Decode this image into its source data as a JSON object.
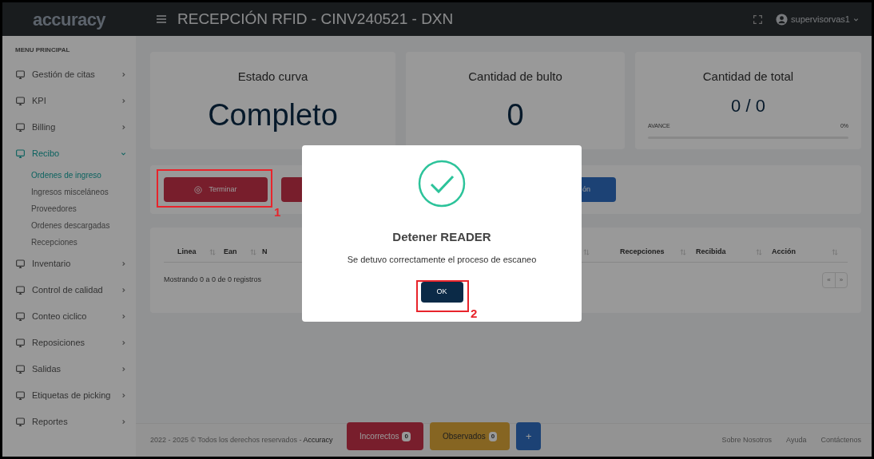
{
  "header": {
    "logo": "accuracy",
    "title": "RECEPCIÓN RFID - CINV240521 - DXN",
    "user": "supervisorvas1"
  },
  "sidebar": {
    "section_label": "MENU PRINCIPAL",
    "items": [
      {
        "label": "Gestión de citas",
        "expanded": false,
        "selected": false
      },
      {
        "label": "KPI",
        "expanded": false,
        "selected": false
      },
      {
        "label": "Billing",
        "expanded": false,
        "selected": false
      },
      {
        "label": "Recibo",
        "expanded": true,
        "selected": true,
        "children": [
          {
            "label": "Ordenes de ingreso",
            "selected": true
          },
          {
            "label": "Ingresos misceláneos",
            "selected": false
          },
          {
            "label": "Proveedores",
            "selected": false
          },
          {
            "label": "Ordenes descargadas",
            "selected": false
          },
          {
            "label": "Recepciones",
            "selected": false
          }
        ]
      },
      {
        "label": "Inventario",
        "expanded": false,
        "selected": false
      },
      {
        "label": "Control de calidad",
        "expanded": false,
        "selected": false
      },
      {
        "label": "Conteo ciclico",
        "expanded": false,
        "selected": false
      },
      {
        "label": "Reposiciones",
        "expanded": false,
        "selected": false
      },
      {
        "label": "Salidas",
        "expanded": false,
        "selected": false
      },
      {
        "label": "Etiquetas de picking",
        "expanded": false,
        "selected": false
      },
      {
        "label": "Reportes",
        "expanded": false,
        "selected": false
      }
    ]
  },
  "cards": [
    {
      "title": "Estado curva",
      "value": "Completo"
    },
    {
      "title": "Cantidad de bulto",
      "value": "0"
    },
    {
      "title": "Cantidad de total",
      "value": "0 / 0",
      "progress_label": "AVANCE",
      "progress_reading": "0%",
      "level": 0
    }
  ],
  "toolbar": {
    "finish_button": "Terminar",
    "action_button_text": "ón"
  },
  "table": {
    "columns": [
      "Linea",
      "Ean",
      "N",
      "Recepciones",
      "Recibida",
      "Acción"
    ],
    "info": "Mostrando 0 a 0 de 0 registros",
    "prev": "«",
    "next": "»"
  },
  "footer": {
    "copyright": "2022 - 2025 © Todos los derechos reservados - ",
    "brand": "Accuracy",
    "links": [
      "Sobre Nosotros",
      "Ayuda",
      "Contáctenos"
    ]
  },
  "floating_buttons": [
    {
      "kind": "error",
      "label": "Incorrectos",
      "count": "0"
    },
    {
      "kind": "warning",
      "label": "Observados",
      "count": "0"
    },
    {
      "kind": "add",
      "label": "+"
    }
  ],
  "dialog": {
    "title": "Detener READER",
    "message": "Se detuvo correctamente el proceso de escaneo",
    "ok": "OK"
  },
  "annotations": [
    "1",
    "2"
  ]
}
